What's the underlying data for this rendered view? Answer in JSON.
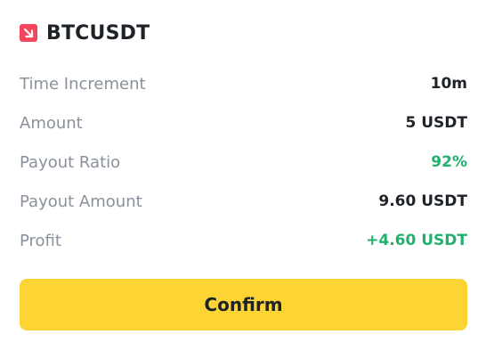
{
  "header": {
    "direction_icon": "arrow-down-right-icon",
    "symbol": "BTCUSDT",
    "icon_color": "#f6465d"
  },
  "details": [
    {
      "label": "Time Increment",
      "value": "10m",
      "value_color": "#1e2329"
    },
    {
      "label": "Amount",
      "value": "5 USDT",
      "value_color": "#1e2329"
    },
    {
      "label": "Payout Ratio",
      "value": "92%",
      "value_color": "#20b26c"
    },
    {
      "label": "Payout Amount",
      "value": "9.60 USDT",
      "value_color": "#1e2329"
    },
    {
      "label": "Profit",
      "value": "+4.60 USDT",
      "value_color": "#20b26c"
    }
  ],
  "confirm": {
    "label": "Confirm",
    "color": "#fcd535"
  }
}
